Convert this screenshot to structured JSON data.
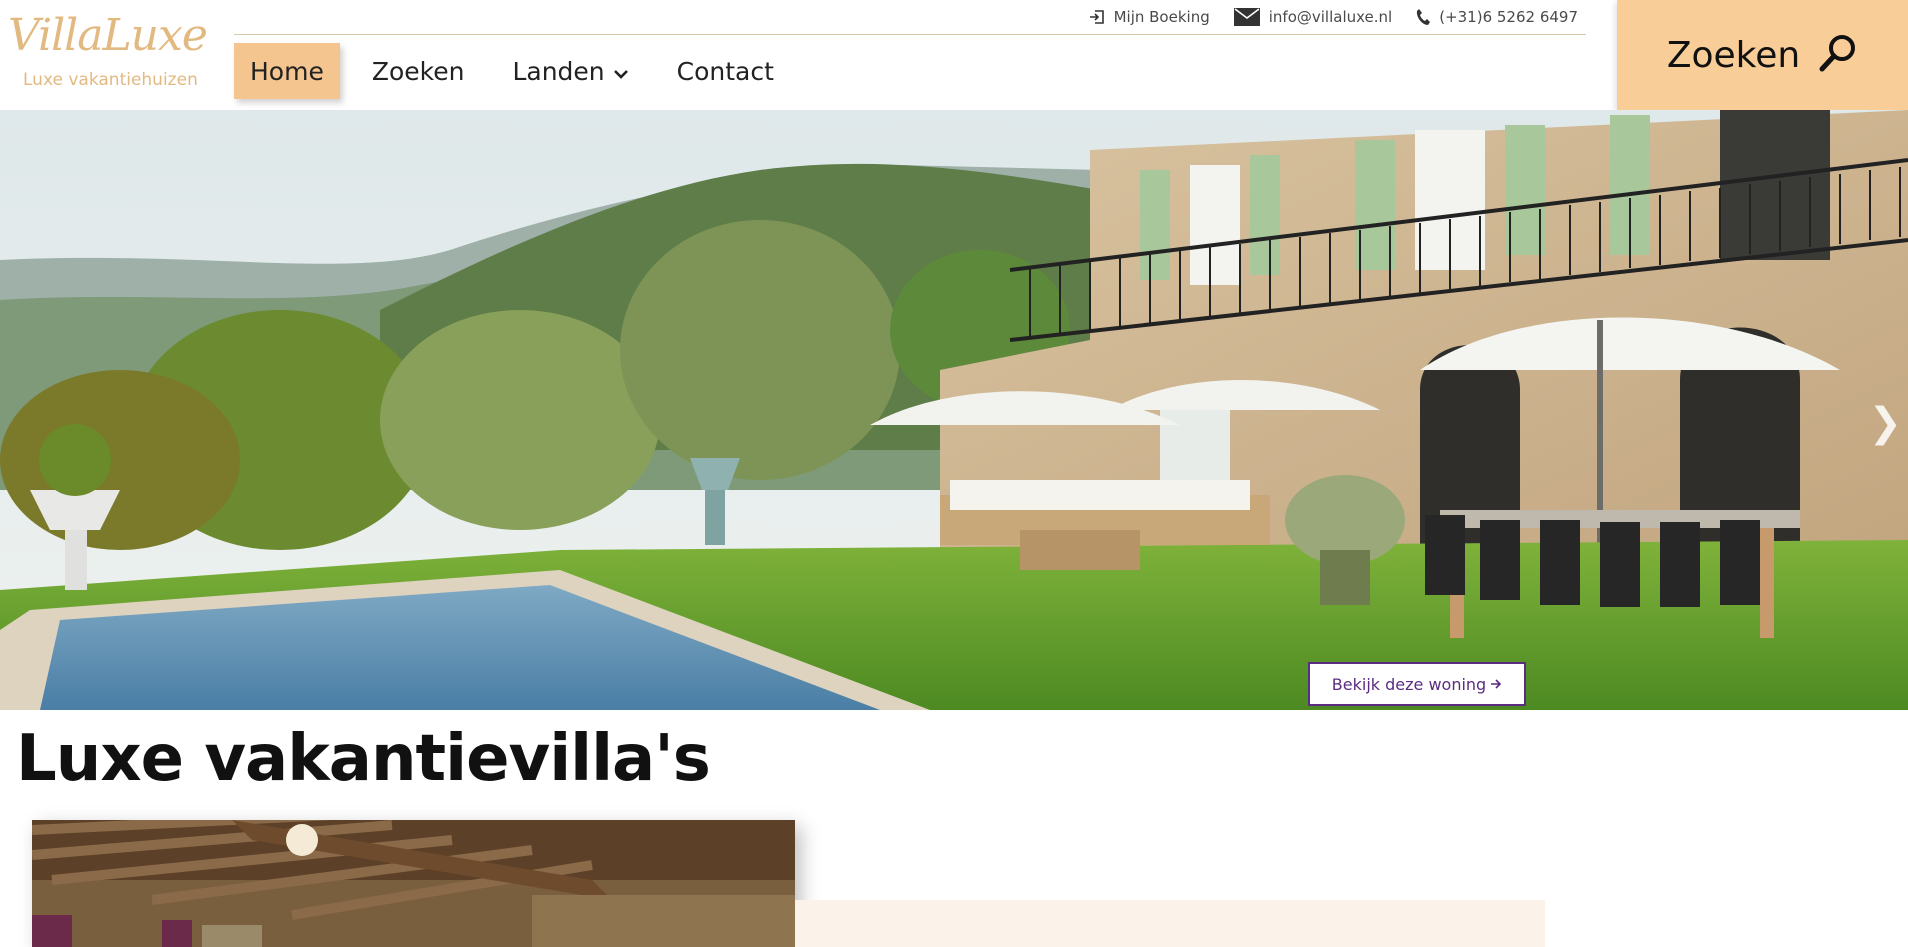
{
  "brand": {
    "name": "VillaLuxe",
    "tagline": "Luxe vakantiehuizen",
    "accent_color": "#f9cd97",
    "link_color": "#5a2d82"
  },
  "topbar": {
    "booking": {
      "label": "Mijn Boeking",
      "icon": "login-icon"
    },
    "email": {
      "label": "info@villaluxe.nl",
      "icon": "envelope-icon"
    },
    "phone": {
      "label": "(+31)6 5262 6497",
      "icon": "phone-icon"
    }
  },
  "nav": {
    "items": [
      {
        "label": "Home",
        "active": true
      },
      {
        "label": "Zoeken",
        "active": false
      },
      {
        "label": "Landen",
        "active": false,
        "has_dropdown": true
      },
      {
        "label": "Contact",
        "active": false
      }
    ]
  },
  "search_cta": {
    "label": "Zoeken",
    "icon": "search-icon"
  },
  "hero": {
    "button_label": "Bekijk deze woning",
    "button_icon": "arrow-right-icon",
    "next_icon": "chevron-right-icon"
  },
  "main": {
    "title": "Luxe vakantievilla's"
  }
}
